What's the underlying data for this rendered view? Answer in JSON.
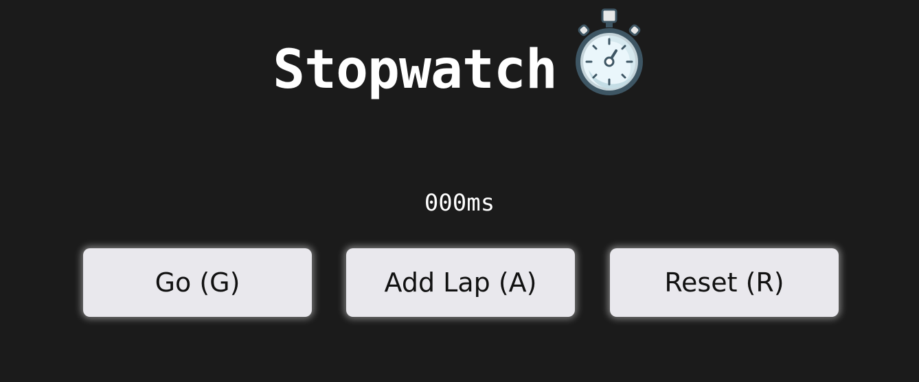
{
  "header": {
    "title": "Stopwatch",
    "icon": "stopwatch-icon"
  },
  "display": {
    "time": "000ms"
  },
  "controls": {
    "go_label": "Go (G)",
    "lap_label": "Add Lap (A)",
    "reset_label": "Reset (R)"
  },
  "colors": {
    "background": "#1b1b1b",
    "text": "#ffffff",
    "button_bg": "#e9e8ed",
    "button_text": "#111111"
  }
}
